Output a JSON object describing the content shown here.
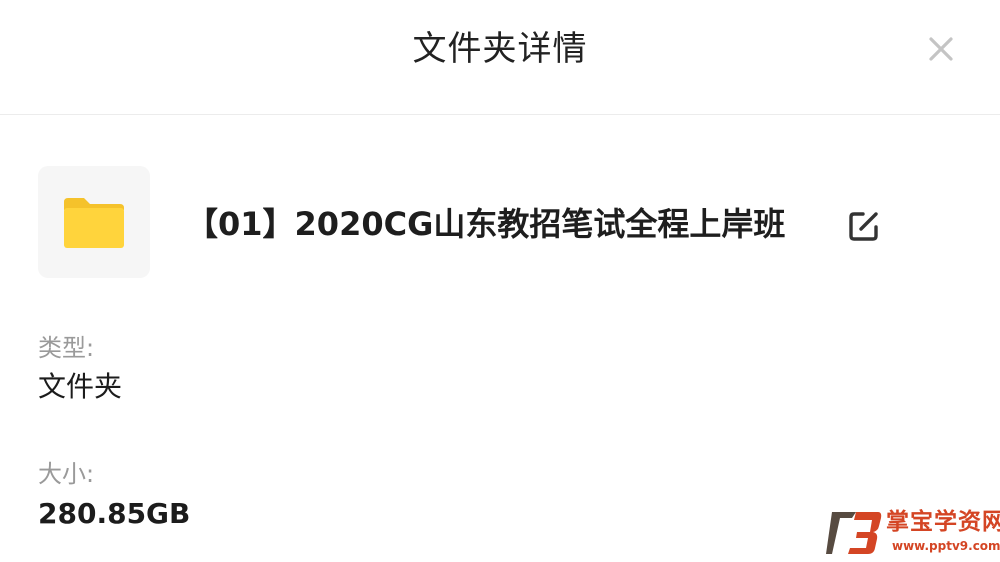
{
  "dialog": {
    "title": "文件夹详情",
    "close_icon": "close-icon"
  },
  "folder": {
    "icon": "folder-icon",
    "icon_color": "#FFD43C",
    "name": "【01】2020CG山东教招笔试全程上岸班",
    "edit_icon": "edit-icon"
  },
  "fields": {
    "type_label": "类型:",
    "type_value": "文件夹",
    "size_label": "大小:",
    "size_value": "280.85GB"
  },
  "watermark": {
    "title": "掌宝学资网",
    "url": "www.pptv9.com",
    "color": "#D44524"
  }
}
